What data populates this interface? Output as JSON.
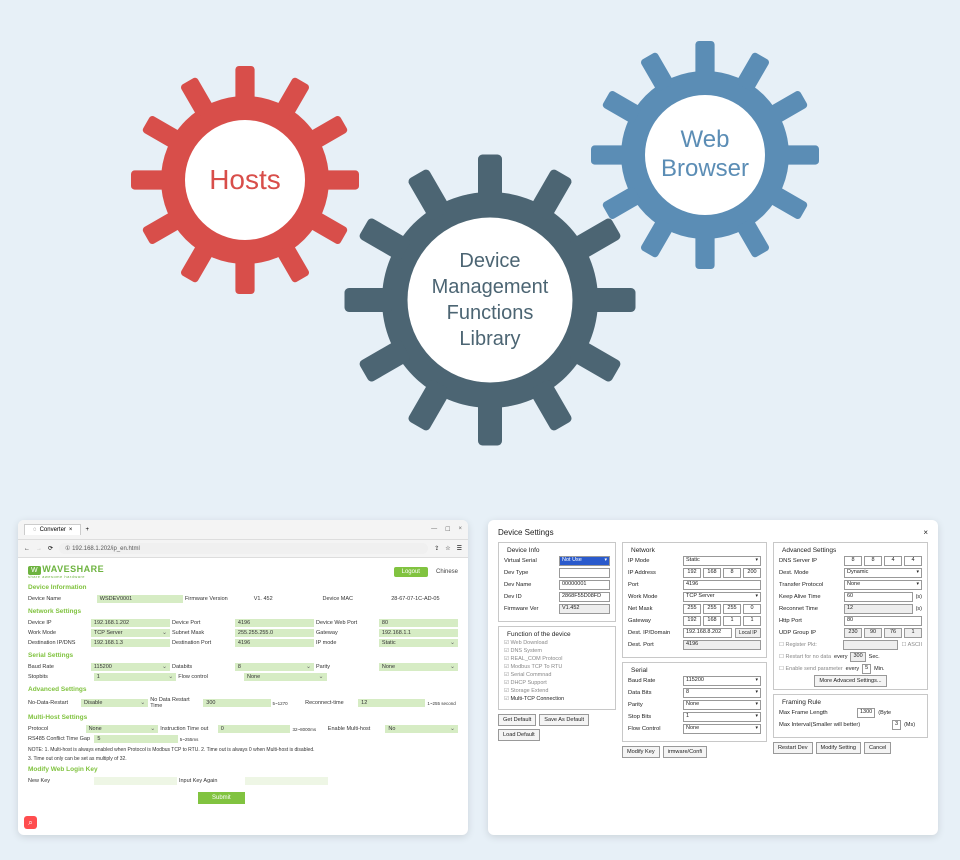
{
  "gears": {
    "hosts": "Hosts",
    "library": "Device\nManagement\nFunctions\nLibrary",
    "browser": "Web\nBrowser"
  },
  "browser_panel": {
    "tab_title": "Converter",
    "url": "192.168.1.202/ip_en.html",
    "logo": "WAVESHARE",
    "logo_sub": "share awesome hardware",
    "logout": "Logout",
    "language": "Chinese",
    "sections": {
      "device_info": "Device Information",
      "network": "Network Settings",
      "serial": "Serial Settings",
      "advanced": "Advanced Settings",
      "multihost": "Multi-Host Settings",
      "modify_key": "Modify Web Login Key"
    },
    "device_info": {
      "name_label": "Device Name",
      "name": "WSDEV0001",
      "fw_label": "Firmware Version",
      "fw": "V1. 452",
      "mac_label": "Device MAC",
      "mac": "28-67-07-1C-AD-05"
    },
    "network": {
      "ip_label": "Device IP",
      "ip": "192.168.1.202",
      "port_label": "Device Port",
      "port": "4196",
      "webport_label": "Device Web Port",
      "webport": "80",
      "work_label": "Work Mode",
      "work": "TCP Server",
      "subnet_label": "Subnet Mask",
      "subnet": "255.255.255.0",
      "gw_label": "Gateway",
      "gw": "192.168.1.1",
      "dest_label": "Destination IP/DNS",
      "dest": "192.168.1.3",
      "dport_label": "Destination Port",
      "dport": "4196",
      "ipmode_label": "IP mode",
      "ipmode": "Static"
    },
    "serial": {
      "baud_label": "Baud Rate",
      "baud": "115200",
      "databits_label": "Databits",
      "databits": "8",
      "parity_label": "Parity",
      "parity": "None",
      "stopbits_label": "Stopbits",
      "stopbits": "1",
      "flow_label": "Flow control",
      "flow": "None"
    },
    "advanced": {
      "nodata_label": "No-Data-Restart",
      "nodata": "Disable",
      "nodata_time_label": "No Data Restart Time",
      "nodata_time": "300",
      "nodata_time_unit": "second",
      "nodata_range": "5~1270",
      "recon_label": "Reconnect-time",
      "recon": "12",
      "recon_range": "1~255 second"
    },
    "multihost": {
      "proto_label": "Protocol",
      "proto": "None",
      "timeout_label": "Instruction Time out",
      "timeout": "0",
      "timeout_range": "32~8000ms",
      "enable_label": "Enable Multi-host",
      "enable": "No",
      "conflict_label": "RS485 Conflict Time Gap",
      "conflict": "5",
      "conflict_range": "5~255ms"
    },
    "notes": {
      "n1": "NOTE: 1. Multi-host is always enabled when Protocol is Modbus TCP to RTU. 2. Time out is always 0 when Multi-host is disabled.",
      "n2": "3. Time out only can be set as multiply of 32."
    },
    "key": {
      "new_label": "New Key",
      "again_label": "Input Key Again"
    },
    "submit": "Submit"
  },
  "settings_panel": {
    "title": "Device Settings",
    "device_info": {
      "legend": "Device Info",
      "vserial_label": "Virtual Serial",
      "vserial": "Not Use",
      "devtype_label": "Dev Type",
      "devtype": "",
      "devname_label": "Dev Name",
      "devname": "00000001",
      "devid_label": "Dev ID",
      "devid": "2868F55D08FD",
      "fw_label": "Firmware Ver",
      "fw": "V1.452"
    },
    "function": {
      "legend": "Function of the device",
      "items": [
        "Web Download",
        "DNS System",
        "REAL_COM Protocol",
        "Modbus TCP To RTU",
        "Serial Commnad",
        "DHCP Support",
        "Storage Extend",
        "Multi-TCP Connection"
      ]
    },
    "network": {
      "legend": "Network",
      "ipmode_label": "IP Mode",
      "ipmode": "Static",
      "ipaddr_label": "IP Address",
      "ipaddr": [
        "192",
        "168",
        "8",
        "200"
      ],
      "port_label": "Port",
      "port": "4196",
      "work_label": "Work Mode",
      "work": "TCP Server",
      "mask_label": "Net Mask",
      "mask": [
        "255",
        "255",
        "255",
        "0"
      ],
      "gw_label": "Gateway",
      "gw": [
        "192",
        "168",
        "1",
        "1"
      ],
      "dest_label": "Dest. IP/Domain",
      "dest": "192.168.8.202",
      "local_ip": "Local IP",
      "dport_label": "Dest. Port",
      "dport": "4196"
    },
    "serial": {
      "legend": "Serial",
      "baud_label": "Baud Rate",
      "baud": "115200",
      "databits_label": "Data Bits",
      "databits": "8",
      "parity_label": "Parity",
      "parity": "None",
      "stopbits_label": "Stop Bits",
      "stopbits": "1",
      "flow_label": "Flow Control",
      "flow": "None"
    },
    "advs": {
      "legend": "Advanced Settings",
      "dns_label": "DNS Server IP",
      "dns": [
        "8",
        "8",
        "4",
        "4"
      ],
      "dmode_label": "Dest. Mode",
      "dmode": "Dynamic",
      "tproto_label": "Transfer Protocol",
      "tproto": "None",
      "keep_label": "Keep Alive Time",
      "keep": "60",
      "keep_u": "(s)",
      "recon_label": "Reconnet Time",
      "recon": "12",
      "recon_u": "(s)",
      "http_label": "Http Port",
      "http": "80",
      "udp_label": "UDP Group IP",
      "udp": [
        "230",
        "90",
        "76",
        "1"
      ],
      "regpkt": "Register Pkt:",
      "ascii": "ASCII",
      "restart": "Restart for no data",
      "restart_every": "every",
      "restart_val": "300",
      "restart_u": "Sec.",
      "enable_send": "Enable send parameter",
      "enable_every": "every",
      "enable_val": "5",
      "enable_u": "Min.",
      "more": "More Advaced Settings..."
    },
    "framing": {
      "legend": "Framing Rule",
      "max_label": "Max Frame Length",
      "max": "1300",
      "max_u": "(Byte",
      "interval_label": "Max Interval(Smaller will better)",
      "interval": "3",
      "interval_u": "(Ms)"
    },
    "buttons": {
      "get": "Get Default",
      "save": "Save As Default",
      "load": "Load Default",
      "modkey": "Modify Key",
      "fw": "irmware/Confi",
      "restart": "Restart Dev",
      "modset": "Modify Setting",
      "cancel": "Cancel"
    }
  }
}
